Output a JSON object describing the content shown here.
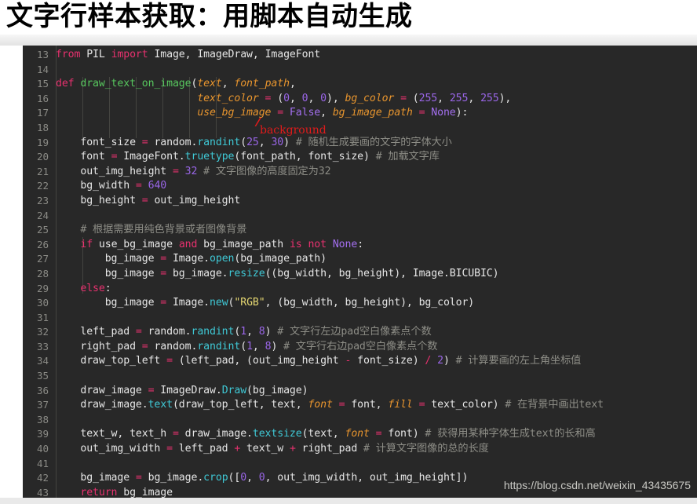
{
  "slide": {
    "title": "文字行样本获取：用脚本自动生成",
    "watermark": "https://blog.csdn.net/weixin_43435675"
  },
  "annotation": {
    "text": "background",
    "mark": "/",
    "color": "#e01b1b"
  },
  "theme": {
    "editor_bg": "#282828",
    "gutter_fg": "#8a8a85",
    "text_fg": "#e6e6e6",
    "keyword": "#e8316f",
    "constant": "#a46ff0",
    "number": "#9a66e8",
    "function": "#3fc9d6",
    "defname": "#57c75e",
    "param": "#e8952e",
    "string": "#e5d772",
    "comment": "#8d8d86",
    "page_bg": "#ffffff"
  },
  "editor": {
    "first_line_number": 13,
    "language": "python",
    "lines": [
      {
        "n": "13",
        "tokens": [
          {
            "t": "from ",
            "c": "kw"
          },
          {
            "t": "PIL ",
            "c": "pl"
          },
          {
            "t": "import ",
            "c": "kw"
          },
          {
            "t": "Image, ImageDraw, ImageFont",
            "c": "pl"
          }
        ]
      },
      {
        "n": "14",
        "tokens": []
      },
      {
        "n": "15",
        "tokens": [
          {
            "t": "def ",
            "c": "kw"
          },
          {
            "t": "draw_text_on_image",
            "c": "def"
          },
          {
            "t": "(",
            "c": "pl"
          },
          {
            "t": "text",
            "c": "param"
          },
          {
            "t": ", ",
            "c": "pl"
          },
          {
            "t": "font_path",
            "c": "param"
          },
          {
            "t": ",",
            "c": "pl"
          }
        ]
      },
      {
        "n": "16",
        "tokens": [
          {
            "t": "                       ",
            "c": "pl"
          },
          {
            "t": "text_color",
            "c": "param"
          },
          {
            "t": " = ",
            "c": "op"
          },
          {
            "t": "(",
            "c": "pl"
          },
          {
            "t": "0",
            "c": "num"
          },
          {
            "t": ", ",
            "c": "pl"
          },
          {
            "t": "0",
            "c": "num"
          },
          {
            "t": ", ",
            "c": "pl"
          },
          {
            "t": "0",
            "c": "num"
          },
          {
            "t": "), ",
            "c": "pl"
          },
          {
            "t": "bg_color",
            "c": "param"
          },
          {
            "t": " = ",
            "c": "op"
          },
          {
            "t": "(",
            "c": "pl"
          },
          {
            "t": "255",
            "c": "num"
          },
          {
            "t": ", ",
            "c": "pl"
          },
          {
            "t": "255",
            "c": "num"
          },
          {
            "t": ", ",
            "c": "pl"
          },
          {
            "t": "255",
            "c": "num"
          },
          {
            "t": "),",
            "c": "pl"
          }
        ]
      },
      {
        "n": "17",
        "tokens": [
          {
            "t": "                       ",
            "c": "pl"
          },
          {
            "t": "use_bg_image",
            "c": "param"
          },
          {
            "t": " = ",
            "c": "op"
          },
          {
            "t": "False",
            "c": "kw2"
          },
          {
            "t": ", ",
            "c": "pl"
          },
          {
            "t": "bg_image_path",
            "c": "param"
          },
          {
            "t": " = ",
            "c": "op"
          },
          {
            "t": "None",
            "c": "kw2"
          },
          {
            "t": "):",
            "c": "pl"
          }
        ]
      },
      {
        "n": "18",
        "tokens": []
      },
      {
        "n": "19",
        "tokens": [
          {
            "t": "    font_size ",
            "c": "pl"
          },
          {
            "t": "=",
            "c": "op"
          },
          {
            "t": " random.",
            "c": "pl"
          },
          {
            "t": "randint",
            "c": "fn"
          },
          {
            "t": "(",
            "c": "pl"
          },
          {
            "t": "25",
            "c": "num"
          },
          {
            "t": ", ",
            "c": "pl"
          },
          {
            "t": "30",
            "c": "num"
          },
          {
            "t": ") ",
            "c": "pl"
          },
          {
            "t": "# 随机生成要画的文字的字体大小",
            "c": "cmt"
          }
        ]
      },
      {
        "n": "20",
        "tokens": [
          {
            "t": "    font ",
            "c": "pl"
          },
          {
            "t": "=",
            "c": "op"
          },
          {
            "t": " ImageFont.",
            "c": "pl"
          },
          {
            "t": "truetype",
            "c": "fn"
          },
          {
            "t": "(font_path, font_size) ",
            "c": "pl"
          },
          {
            "t": "# 加载文字库",
            "c": "cmt"
          }
        ]
      },
      {
        "n": "21",
        "tokens": [
          {
            "t": "    out_img_height ",
            "c": "pl"
          },
          {
            "t": "=",
            "c": "op"
          },
          {
            "t": " ",
            "c": "pl"
          },
          {
            "t": "32",
            "c": "num"
          },
          {
            "t": " ",
            "c": "pl"
          },
          {
            "t": "# 文字图像的高度固定为32",
            "c": "cmt"
          }
        ]
      },
      {
        "n": "22",
        "tokens": [
          {
            "t": "    bg_width ",
            "c": "pl"
          },
          {
            "t": "=",
            "c": "op"
          },
          {
            "t": " ",
            "c": "pl"
          },
          {
            "t": "640",
            "c": "num"
          }
        ]
      },
      {
        "n": "23",
        "tokens": [
          {
            "t": "    bg_height ",
            "c": "pl"
          },
          {
            "t": "=",
            "c": "op"
          },
          {
            "t": " out_img_height",
            "c": "pl"
          }
        ]
      },
      {
        "n": "24",
        "tokens": []
      },
      {
        "n": "25",
        "tokens": [
          {
            "t": "    # 根据需要用纯色背景或者图像背景",
            "c": "cmt"
          }
        ]
      },
      {
        "n": "26",
        "tokens": [
          {
            "t": "    ",
            "c": "pl"
          },
          {
            "t": "if",
            "c": "kw"
          },
          {
            "t": " use_bg_image ",
            "c": "pl"
          },
          {
            "t": "and",
            "c": "kw"
          },
          {
            "t": " bg_image_path ",
            "c": "pl"
          },
          {
            "t": "is",
            "c": "kw"
          },
          {
            "t": " ",
            "c": "pl"
          },
          {
            "t": "not",
            "c": "kw"
          },
          {
            "t": " ",
            "c": "pl"
          },
          {
            "t": "None",
            "c": "kw2"
          },
          {
            "t": ":",
            "c": "pl"
          }
        ]
      },
      {
        "n": "27",
        "tokens": [
          {
            "t": "        bg_image ",
            "c": "pl"
          },
          {
            "t": "=",
            "c": "op"
          },
          {
            "t": " Image.",
            "c": "pl"
          },
          {
            "t": "open",
            "c": "fn"
          },
          {
            "t": "(bg_image_path)",
            "c": "pl"
          }
        ]
      },
      {
        "n": "28",
        "tokens": [
          {
            "t": "        bg_image ",
            "c": "pl"
          },
          {
            "t": "=",
            "c": "op"
          },
          {
            "t": " bg_image.",
            "c": "pl"
          },
          {
            "t": "resize",
            "c": "fn"
          },
          {
            "t": "((bg_width, bg_height), Image.BICUBIC)",
            "c": "pl"
          }
        ]
      },
      {
        "n": "29",
        "tokens": [
          {
            "t": "    ",
            "c": "pl"
          },
          {
            "t": "else",
            "c": "kw"
          },
          {
            "t": ":",
            "c": "pl"
          }
        ]
      },
      {
        "n": "30",
        "tokens": [
          {
            "t": "        bg_image ",
            "c": "pl"
          },
          {
            "t": "=",
            "c": "op"
          },
          {
            "t": " Image.",
            "c": "pl"
          },
          {
            "t": "new",
            "c": "fn"
          },
          {
            "t": "(",
            "c": "pl"
          },
          {
            "t": "\"RGB\"",
            "c": "str"
          },
          {
            "t": ", (bg_width, bg_height), bg_color)",
            "c": "pl"
          }
        ]
      },
      {
        "n": "31",
        "tokens": []
      },
      {
        "n": "32",
        "tokens": [
          {
            "t": "    left_pad ",
            "c": "pl"
          },
          {
            "t": "=",
            "c": "op"
          },
          {
            "t": " random.",
            "c": "pl"
          },
          {
            "t": "randint",
            "c": "fn"
          },
          {
            "t": "(",
            "c": "pl"
          },
          {
            "t": "1",
            "c": "num"
          },
          {
            "t": ", ",
            "c": "pl"
          },
          {
            "t": "8",
            "c": "num"
          },
          {
            "t": ") ",
            "c": "pl"
          },
          {
            "t": "# 文字行左边pad空白像素点个数",
            "c": "cmt"
          }
        ]
      },
      {
        "n": "33",
        "tokens": [
          {
            "t": "    right_pad ",
            "c": "pl"
          },
          {
            "t": "=",
            "c": "op"
          },
          {
            "t": " random.",
            "c": "pl"
          },
          {
            "t": "randint",
            "c": "fn"
          },
          {
            "t": "(",
            "c": "pl"
          },
          {
            "t": "1",
            "c": "num"
          },
          {
            "t": ", ",
            "c": "pl"
          },
          {
            "t": "8",
            "c": "num"
          },
          {
            "t": ") ",
            "c": "pl"
          },
          {
            "t": "# 文字行右边pad空白像素点个数",
            "c": "cmt"
          }
        ]
      },
      {
        "n": "34",
        "tokens": [
          {
            "t": "    draw_top_left ",
            "c": "pl"
          },
          {
            "t": "=",
            "c": "op"
          },
          {
            "t": " (left_pad, (out_img_height ",
            "c": "pl"
          },
          {
            "t": "-",
            "c": "op"
          },
          {
            "t": " font_size) ",
            "c": "pl"
          },
          {
            "t": "/",
            "c": "op"
          },
          {
            "t": " ",
            "c": "pl"
          },
          {
            "t": "2",
            "c": "num"
          },
          {
            "t": ") ",
            "c": "pl"
          },
          {
            "t": "# 计算要画的左上角坐标值",
            "c": "cmt"
          }
        ]
      },
      {
        "n": "35",
        "tokens": []
      },
      {
        "n": "36",
        "tokens": [
          {
            "t": "    draw_image ",
            "c": "pl"
          },
          {
            "t": "=",
            "c": "op"
          },
          {
            "t": " ImageDraw.",
            "c": "pl"
          },
          {
            "t": "Draw",
            "c": "fn"
          },
          {
            "t": "(bg_image)",
            "c": "pl"
          }
        ]
      },
      {
        "n": "37",
        "tokens": [
          {
            "t": "    draw_image.",
            "c": "pl"
          },
          {
            "t": "text",
            "c": "fn"
          },
          {
            "t": "(draw_top_left, text, ",
            "c": "pl"
          },
          {
            "t": "font",
            "c": "param"
          },
          {
            "t": " = ",
            "c": "op"
          },
          {
            "t": "font, ",
            "c": "pl"
          },
          {
            "t": "fill",
            "c": "param"
          },
          {
            "t": " = ",
            "c": "op"
          },
          {
            "t": "text_color) ",
            "c": "pl"
          },
          {
            "t": "# 在背景中画出text",
            "c": "cmt"
          }
        ]
      },
      {
        "n": "38",
        "tokens": []
      },
      {
        "n": "39",
        "tokens": [
          {
            "t": "    text_w, text_h ",
            "c": "pl"
          },
          {
            "t": "=",
            "c": "op"
          },
          {
            "t": " draw_image.",
            "c": "pl"
          },
          {
            "t": "textsize",
            "c": "fn"
          },
          {
            "t": "(text, ",
            "c": "pl"
          },
          {
            "t": "font",
            "c": "param"
          },
          {
            "t": " = ",
            "c": "op"
          },
          {
            "t": "font) ",
            "c": "pl"
          },
          {
            "t": "# 获得用某种字体生成text的长和高",
            "c": "cmt"
          }
        ]
      },
      {
        "n": "40",
        "tokens": [
          {
            "t": "    out_img_width ",
            "c": "pl"
          },
          {
            "t": "=",
            "c": "op"
          },
          {
            "t": " left_pad ",
            "c": "pl"
          },
          {
            "t": "+",
            "c": "op"
          },
          {
            "t": " text_w ",
            "c": "pl"
          },
          {
            "t": "+",
            "c": "op"
          },
          {
            "t": " right_pad ",
            "c": "pl"
          },
          {
            "t": "# 计算文字图像的总的长度",
            "c": "cmt"
          }
        ]
      },
      {
        "n": "41",
        "tokens": []
      },
      {
        "n": "42",
        "tokens": [
          {
            "t": "    bg_image ",
            "c": "pl"
          },
          {
            "t": "=",
            "c": "op"
          },
          {
            "t": " bg_image.",
            "c": "pl"
          },
          {
            "t": "crop",
            "c": "fn"
          },
          {
            "t": "([",
            "c": "pl"
          },
          {
            "t": "0",
            "c": "num"
          },
          {
            "t": ", ",
            "c": "pl"
          },
          {
            "t": "0",
            "c": "num"
          },
          {
            "t": ", out_img_width, out_img_height])",
            "c": "pl"
          }
        ]
      },
      {
        "n": "43",
        "tokens": [
          {
            "t": "    ",
            "c": "pl"
          },
          {
            "t": "return",
            "c": "kw"
          },
          {
            "t": " bg_image",
            "c": "pl"
          }
        ]
      }
    ]
  }
}
